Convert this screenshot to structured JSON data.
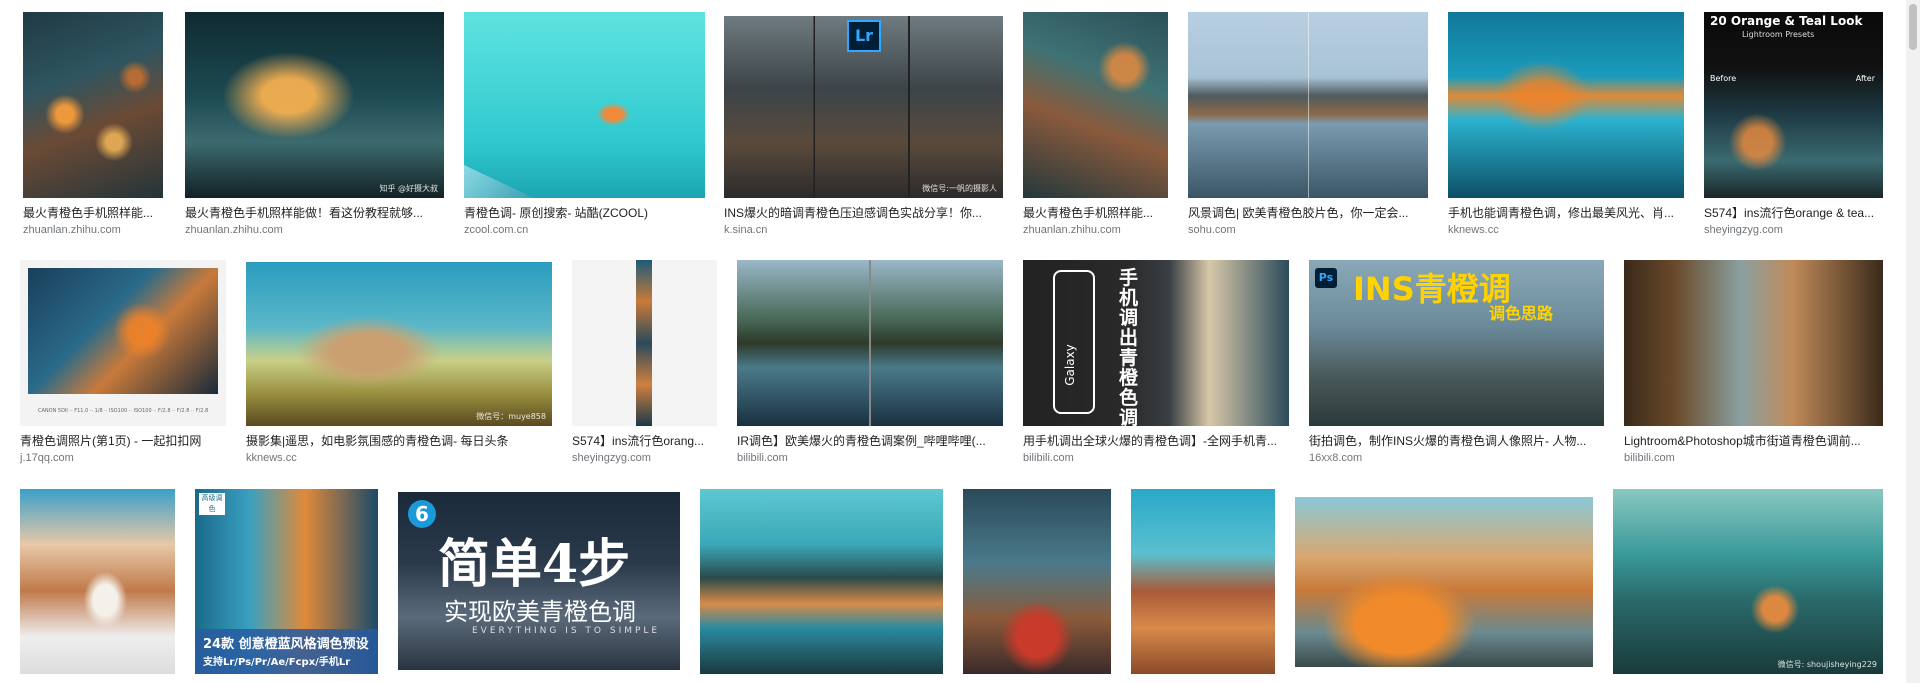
{
  "results": [
    {
      "caption": "最火青橙色手机照样能...",
      "source": "zhuanlan.zhihu.com"
    },
    {
      "caption": "最火青橙色手机照样能做！看这份教程就够...",
      "source": "zhuanlan.zhihu.com",
      "watermark": "知乎 @好摄大叔"
    },
    {
      "caption": "青橙色调- 原创搜索- 站酷(ZCOOL)",
      "source": "zcool.com.cn"
    },
    {
      "caption": "INS爆火的暗调青橙色压迫感调色实战分享！你...",
      "source": "k.sina.cn",
      "overlay": "Lr",
      "watermark": "微信号:一帆的摄影人"
    },
    {
      "caption": "最火青橙色手机照样能...",
      "source": "zhuanlan.zhihu.com"
    },
    {
      "caption": "风景调色| 欧美青橙色胶片色，你一定会...",
      "source": "sohu.com"
    },
    {
      "caption": "手机也能调青橙色调，修出最美风光、肖...",
      "source": "kknews.cc"
    },
    {
      "caption": "S574】ins流行色orange & tea...",
      "source": "sheyingzyg.com",
      "overlay": "20 Orange & Teal Look",
      "overlay_sub": "Lightroom Presets",
      "before": "Before",
      "after": "After"
    },
    {
      "caption": "青橙色调照片(第1页) - 一起扣扣网",
      "source": "j.17qq.com",
      "overlay": "CANON 5DII ·· F11.0 ·· 1/8 ·· ISO100 ·· ISO100 ·· F/2.8 ·· F/2.8 ·· F/2.8"
    },
    {
      "caption": "摄影集|遥思，如电影氛围感的青橙色调- 每日头条",
      "source": "kknews.cc",
      "watermark": "微信号：muye858"
    },
    {
      "caption": "S574】ins流行色orang...",
      "source": "sheyingzyg.com"
    },
    {
      "caption": "IR调色】欧美爆火的青橙色调案例_哔哩哔哩(...",
      "source": "bilibili.com"
    },
    {
      "caption": "用手机调出全球火爆的青橙色调】-全网手机青...",
      "source": "bilibili.com",
      "overlay": "手机调出青橙色调",
      "brand": "Galaxy"
    },
    {
      "caption": "街拍调色，制作INS火爆的青橙色调人像照片- 人物...",
      "source": "16xx8.com",
      "overlay": "INS青橙调",
      "overlay_sub": "调色思路",
      "badge": "Ps"
    },
    {
      "caption": "Lightroom&Photoshop城市街道青橙色调前...",
      "source": "bilibili.com"
    },
    {
      "caption": "",
      "source": ""
    },
    {
      "caption": "",
      "source": "",
      "overlay": "24款 创意橙蓝风格调色预设",
      "overlay_sub": "支持Lr/Ps/Pr/Ae/Fcpx/手机Lr",
      "badge": "高级调色"
    },
    {
      "caption": "",
      "source": "",
      "overlay": "简单4步",
      "overlay_sub": "实现欧美青橙色调",
      "overlay_sub2": "EVERYTHING IS TO SIMPLE",
      "badge": "6"
    },
    {
      "caption": "",
      "source": ""
    },
    {
      "caption": "",
      "source": ""
    },
    {
      "caption": "",
      "source": ""
    },
    {
      "caption": "",
      "source": ""
    },
    {
      "caption": "",
      "source": "",
      "watermark": "微信号: shoujisheying229"
    }
  ],
  "icons": {
    "scrollbar": "vertical-scrollbar"
  }
}
